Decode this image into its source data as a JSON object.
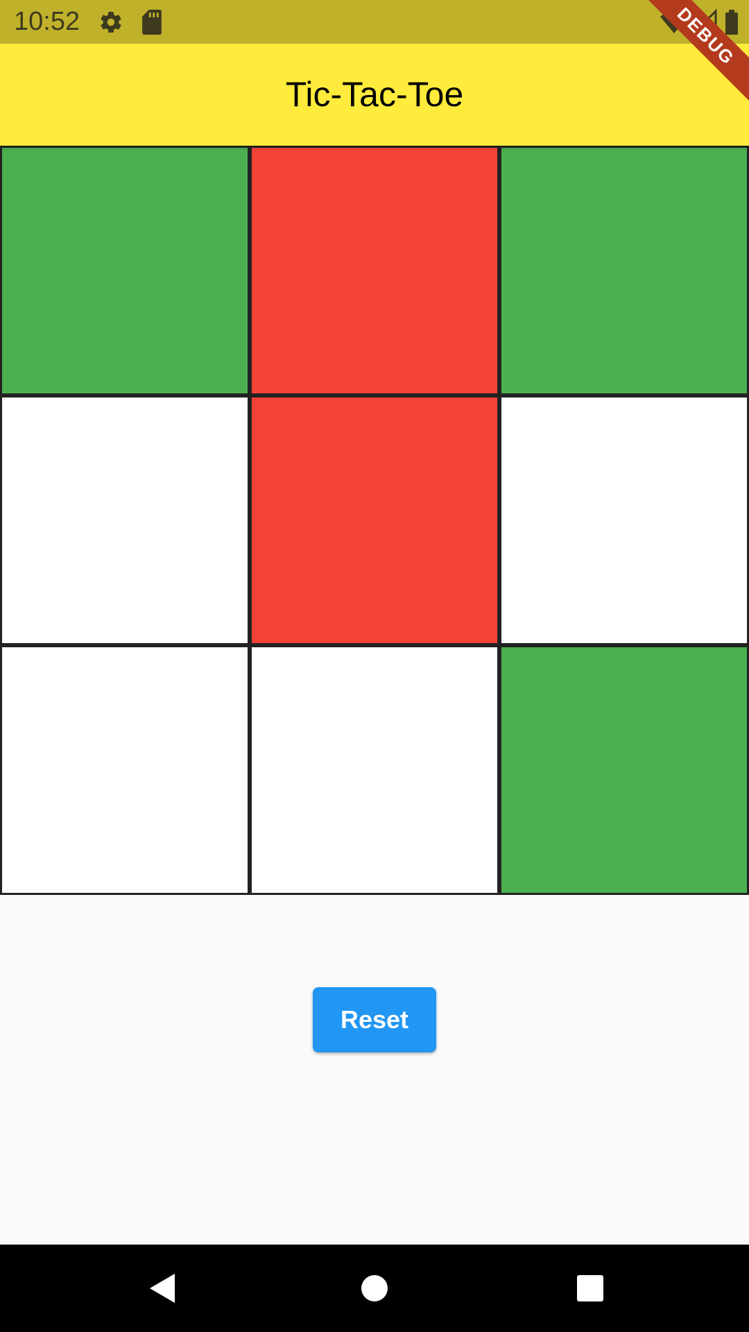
{
  "status_bar": {
    "time": "10:52",
    "icons": [
      "gear-icon",
      "sd-card-icon",
      "wifi-icon",
      "signal-icon",
      "battery-icon"
    ]
  },
  "app_bar": {
    "title": "Tic-Tac-Toe",
    "color": "#ffeb3b"
  },
  "debug_banner": "DEBUG",
  "board": {
    "cells": [
      {
        "color": "#4caf50"
      },
      {
        "color": "#f44336"
      },
      {
        "color": "#4caf50"
      },
      {
        "color": "#ffffff"
      },
      {
        "color": "#f44336"
      },
      {
        "color": "#ffffff"
      },
      {
        "color": "#ffffff"
      },
      {
        "color": "#ffffff"
      },
      {
        "color": "#4caf50"
      }
    ]
  },
  "reset_button": {
    "label": "Reset",
    "color": "#2196f3"
  },
  "nav_bar": {
    "buttons": [
      "back-icon",
      "home-icon",
      "recents-icon"
    ]
  }
}
